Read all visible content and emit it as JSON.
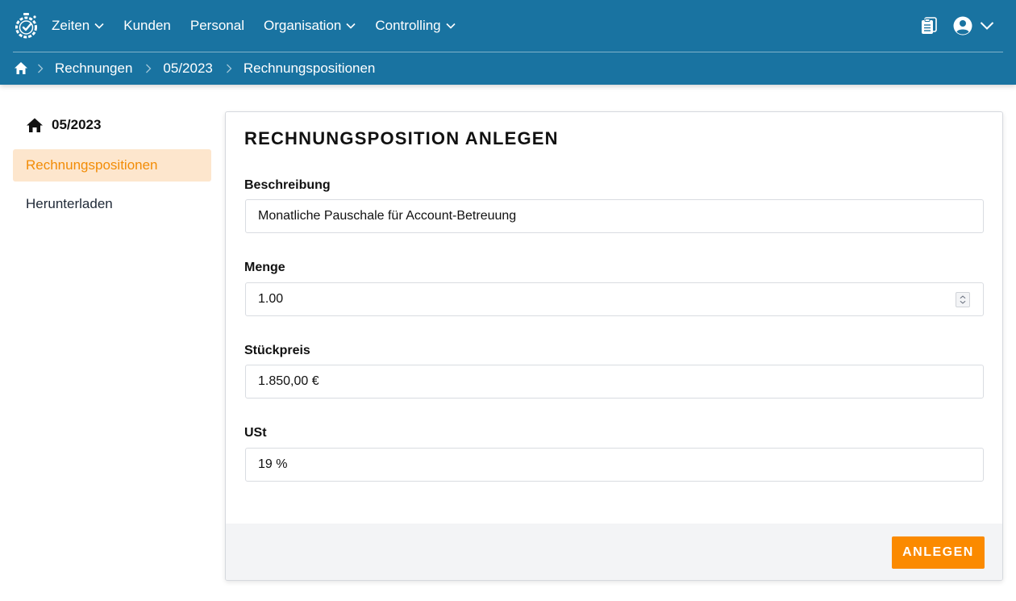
{
  "nav": {
    "items": [
      {
        "label": "Zeiten",
        "has_dropdown": true
      },
      {
        "label": "Kunden",
        "has_dropdown": false
      },
      {
        "label": "Personal",
        "has_dropdown": false
      },
      {
        "label": "Organisation",
        "has_dropdown": true
      },
      {
        "label": "Controlling",
        "has_dropdown": true
      }
    ],
    "icons": {
      "logo": "stopwatch-gear-icon",
      "clipboard": "clipboard-icon",
      "user": "user-circle-icon"
    }
  },
  "breadcrumb": {
    "items": [
      "Rechnungen",
      "05/2023",
      "Rechnungspositionen"
    ]
  },
  "sidebar": {
    "title": "05/2023",
    "items": [
      {
        "label": "Rechnungspositionen",
        "active": true
      },
      {
        "label": "Herunterladen",
        "active": false
      }
    ]
  },
  "form": {
    "title": "RECHNUNGSPOSITION ANLEGEN",
    "fields": {
      "beschreibung": {
        "label": "Beschreibung",
        "value": "Monatliche Pauschale für Account-Betreuung"
      },
      "menge": {
        "label": "Menge",
        "value": "1.00"
      },
      "stueckpreis": {
        "label": "Stückpreis",
        "value": "1.850,00 €"
      },
      "ust": {
        "label": "USt",
        "value": "19 %"
      }
    },
    "submit_label": "ANLEGEN"
  },
  "colors": {
    "topbar": "#1973a1",
    "accent": "#fb8a00",
    "active_bg": "#fde6cd",
    "active_text": "#f28c06"
  }
}
